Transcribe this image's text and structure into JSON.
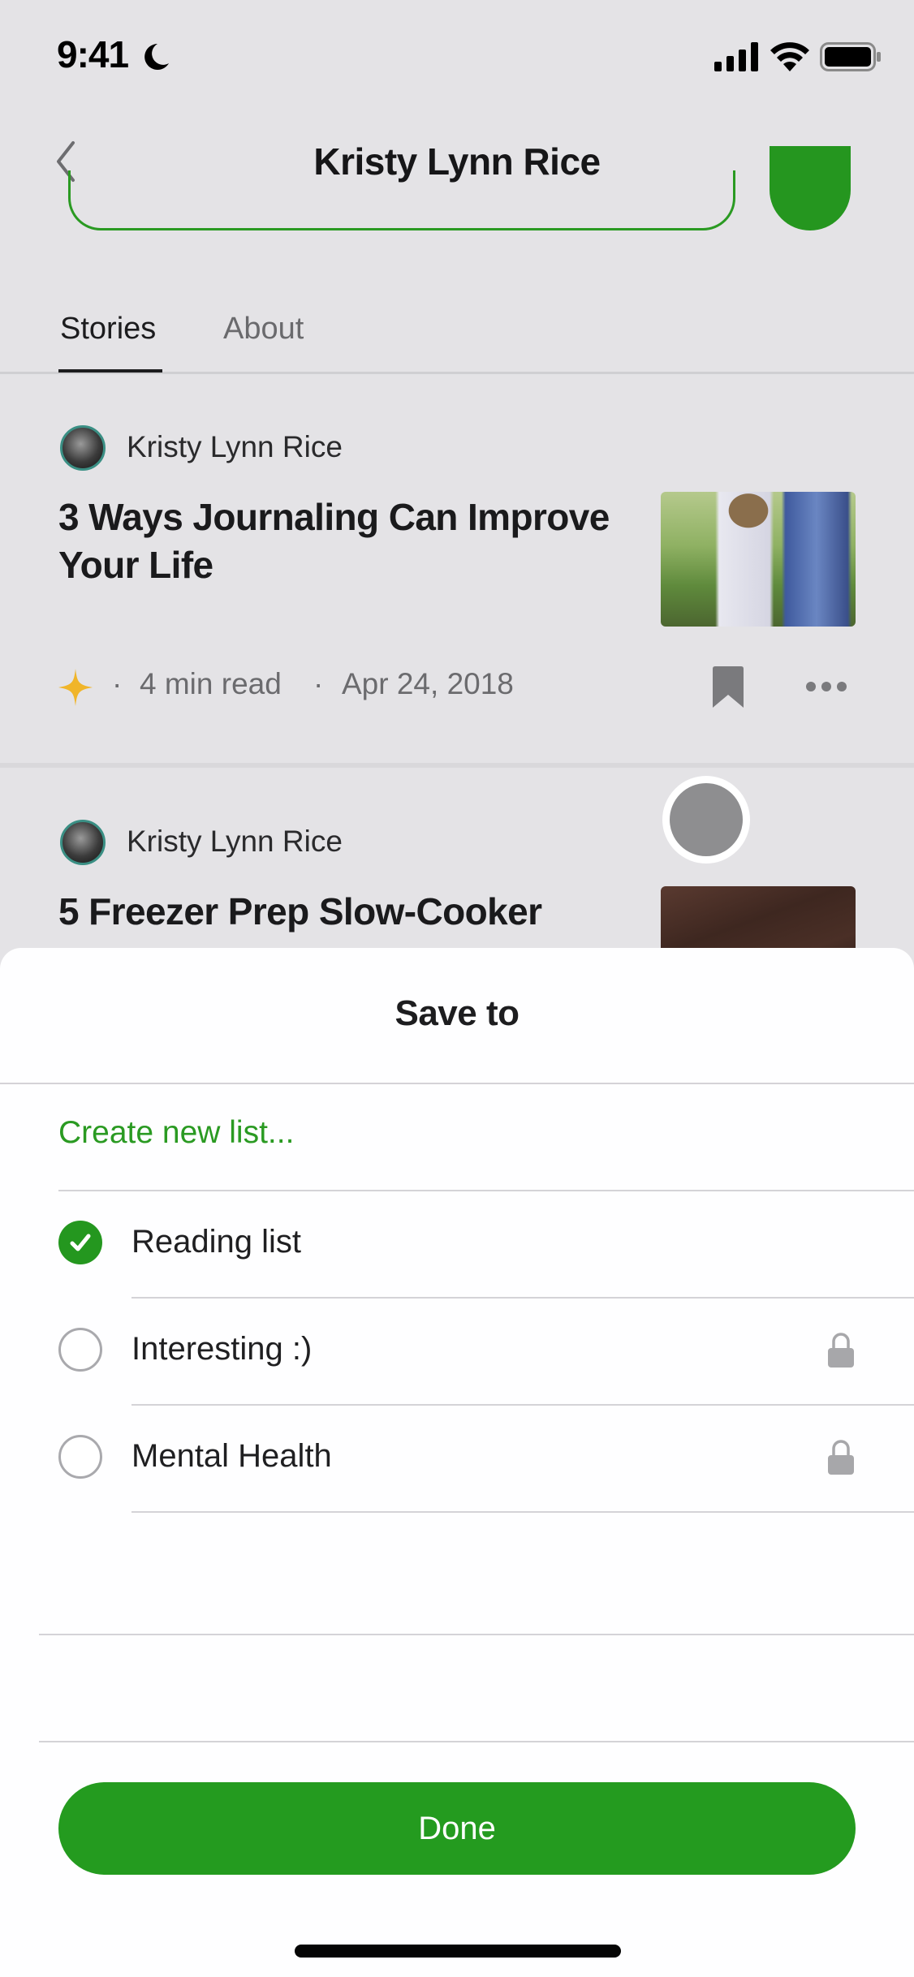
{
  "status_bar": {
    "time": "9:41"
  },
  "nav": {
    "title": "Kristy Lynn Rice"
  },
  "tabs": [
    {
      "label": "Stories",
      "active": true
    },
    {
      "label": "About",
      "active": false
    }
  ],
  "stories": [
    {
      "author": "Kristy Lynn Rice",
      "title": "3 Ways Journaling Can Improve Your Life",
      "separator": "·",
      "read_time": "4  min read",
      "date": "Apr 24, 2018"
    },
    {
      "author": "Kristy Lynn Rice",
      "title": "5 Freezer Prep Slow-Cooker"
    }
  ],
  "sheet": {
    "title": "Save to",
    "create_label": "Create new list...",
    "lists": [
      {
        "label": "Reading list",
        "checked": true,
        "locked": false
      },
      {
        "label": "Interesting :)",
        "checked": false,
        "locked": true
      },
      {
        "label": "Mental Health",
        "checked": false,
        "locked": true
      }
    ],
    "done_label": "Done"
  },
  "colors": {
    "accent": "#249b1f",
    "background": "#e4e3e6",
    "sheet": "#fefeff"
  }
}
